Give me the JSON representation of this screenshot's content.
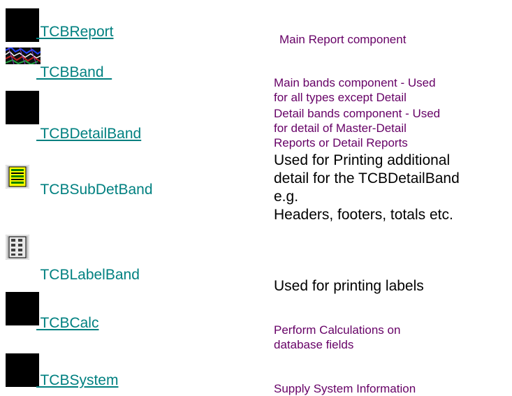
{
  "components": [
    {
      "icon": "black-square-icon",
      "name": " TCBReport",
      "underlined": true,
      "description": [
        "Main Report component"
      ]
    },
    {
      "icon": "band-pattern-icon",
      "name": " TCBBand  ",
      "underlined": true,
      "description": [
        "Main bands component - Used",
        "for all types except Detail"
      ]
    },
    {
      "icon": "black-square-icon",
      "name": " TCBDetailBand",
      "underlined": true,
      "description": [
        "Detail bands component - Used",
        "for detail of Master-Detail",
        "Reports or Detail Reports"
      ]
    },
    {
      "icon": "subdetail-band-icon",
      "name": " TCBSubDetBand",
      "underlined": false,
      "description": [
        "Used for Printing additional",
        "detail for the TCBDetailBand",
        "e.g.",
        "Headers, footers, totals etc."
      ]
    },
    {
      "icon": "label-band-icon",
      "name": " TCBLabelBand",
      "underlined": false,
      "description": [
        "Used for printing labels"
      ]
    },
    {
      "icon": "black-square-icon",
      "name": " TCBCalc",
      "underlined": true,
      "description": [
        "Perform Calculations on",
        "database fields"
      ]
    },
    {
      "icon": "black-square-icon",
      "name": " TCBSystem",
      "underlined": true,
      "description": [
        "Supply System Information"
      ]
    }
  ]
}
